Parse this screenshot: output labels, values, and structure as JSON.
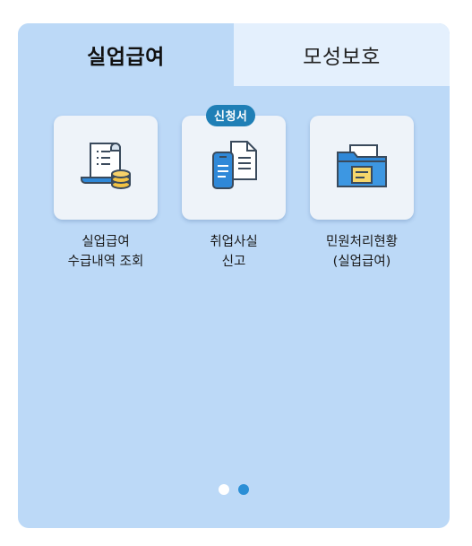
{
  "tabs": [
    {
      "label": "실업급여",
      "active": true
    },
    {
      "label": "모성보호",
      "active": false
    }
  ],
  "menu_items": [
    {
      "line1": "실업급여",
      "line2": "수급내역 조회",
      "icon": "receipt-coins-icon"
    },
    {
      "line1": "취업사실",
      "line2": "신고",
      "icon": "phone-document-icon",
      "badge": "신청서"
    },
    {
      "line1": "민원처리현황",
      "line2": "(실업급여)",
      "icon": "folder-icon"
    }
  ],
  "pagination": {
    "total": 2,
    "current": 2
  },
  "colors": {
    "panel_bg": "#bcd9f7",
    "inactive_tab_bg": "#e4f0fd",
    "badge_bg": "#1f7fb6",
    "accent": "#2b8fd6"
  }
}
